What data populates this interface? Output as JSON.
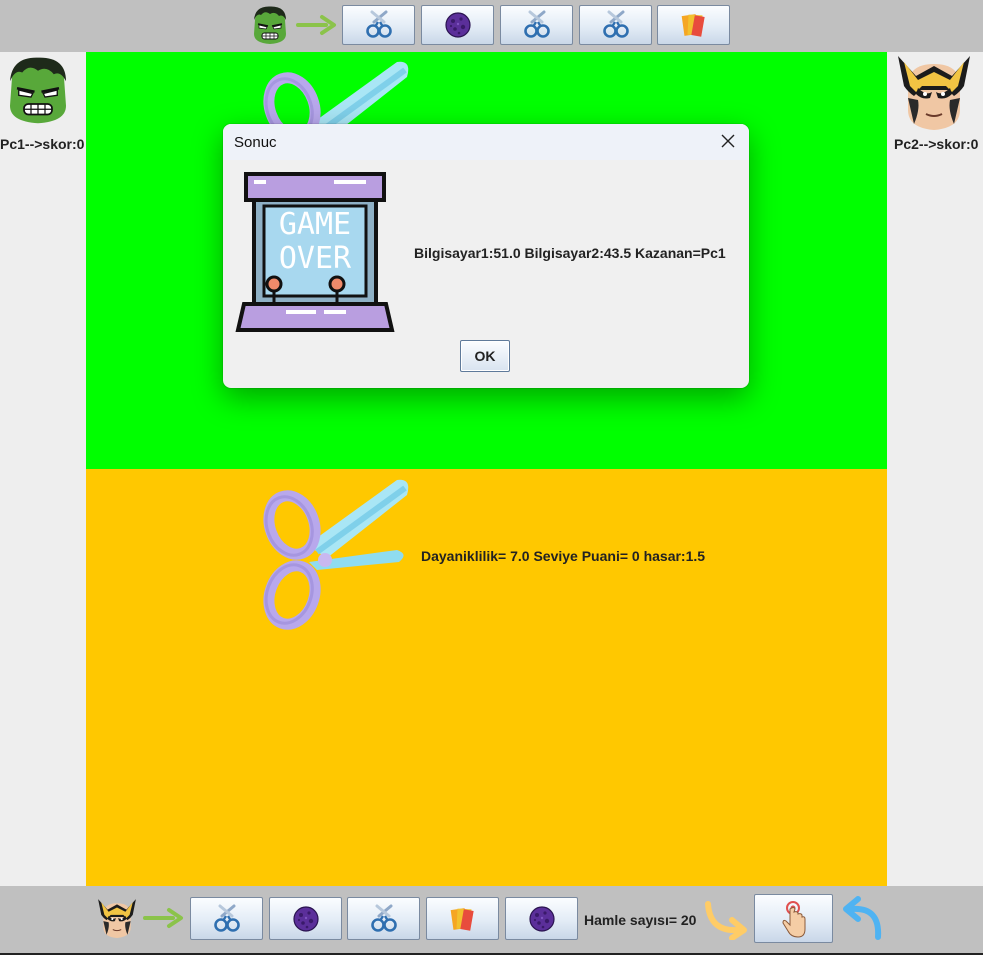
{
  "dialog": {
    "title": "Sonuc",
    "message": "Bilgisayar1:51.0 Bilgisayar2:43.5 Kazanan=Pc1",
    "ok_label": "OK",
    "image_text_line1": "GAME",
    "image_text_line2": "OVER"
  },
  "players": {
    "pc1": {
      "score_label": "Pc1-->skor:0",
      "avatar": "hulk"
    },
    "pc2": {
      "score_label": "Pc2-->skor:0",
      "avatar": "wolverine"
    }
  },
  "top_hand": [
    "scissors",
    "rock",
    "scissors",
    "scissors",
    "paper"
  ],
  "bottom_hand": [
    "scissors",
    "rock",
    "scissors",
    "paper",
    "rock"
  ],
  "board": {
    "top_card": "scissors",
    "bottom_card": "scissors",
    "bottom_card_info": "Dayaniklilik= 7.0 Seviye Puani= 0 hasar:1.5"
  },
  "move_count_label": "Hamle sayısı= 20",
  "colors": {
    "top_field": "#00ff00",
    "bottom_field": "#ffc800",
    "bar": "#c0c0c0",
    "arrow_green": "#8bc34a",
    "arrow_yellow": "#ffcc66",
    "arrow_blue": "#4fb3f2"
  }
}
